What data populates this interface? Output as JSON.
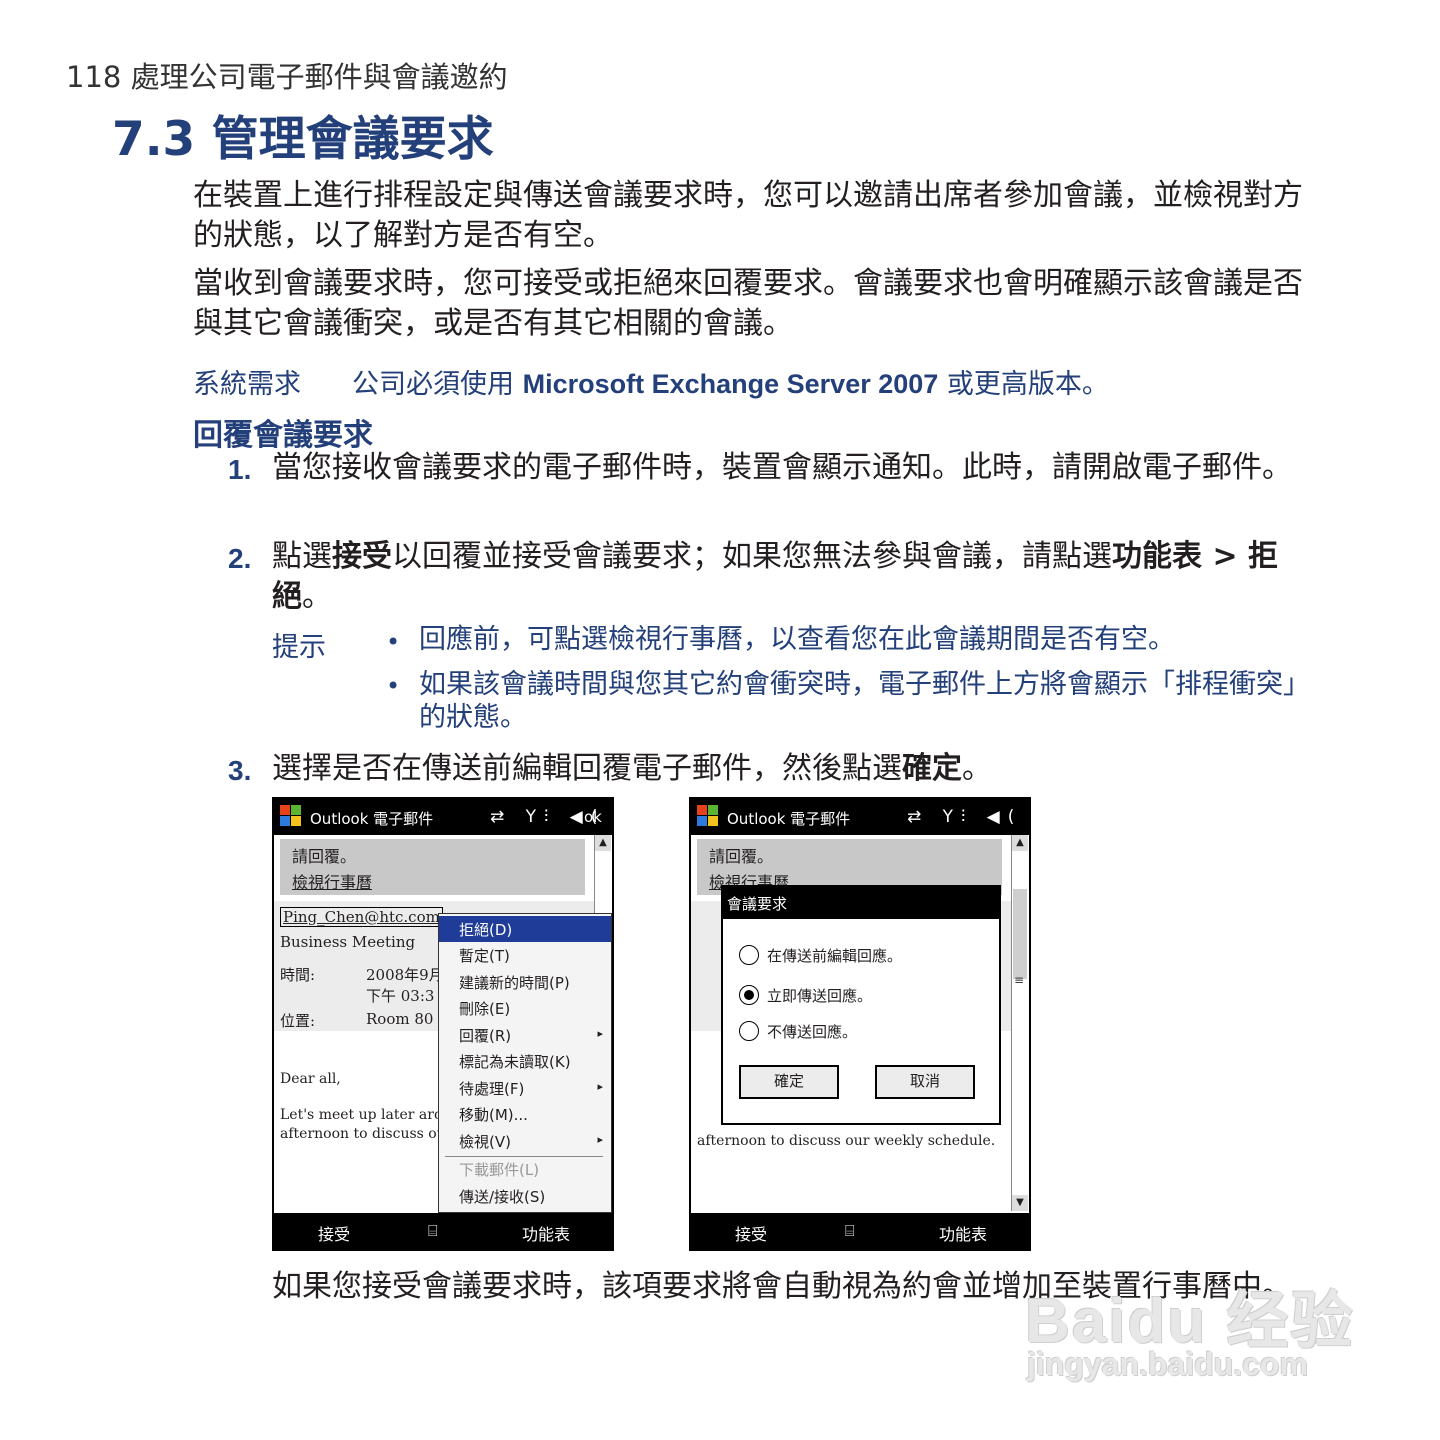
{
  "running_head": "118 處理公司電子郵件與會議邀約",
  "section_title": "7.3 管理會議要求",
  "paragraphs": [
    "在裝置上進行排程設定與傳送會議要求時，您可以邀請出席者參加會議，並檢視對方的狀態，以了解對方是否有空。",
    "當收到會議要求時，您可接受或拒絕來回覆要求。會議要求也會明確顯示該會議是否與其它會議衝突，或是否有其它相關的會議。"
  ],
  "requirement": {
    "label": "系統需求",
    "text_before": "公司必須使用 ",
    "text_bold": "Microsoft Exchange Server 2007",
    "text_after": " 或更高版本。"
  },
  "subheading": "回覆會議要求",
  "steps": [
    {
      "num": "1.",
      "text": "當您接收會議要求的電子郵件時，裝置會顯示通知。此時，請開啟電子郵件。"
    },
    {
      "num": "2.",
      "pre": "點選",
      "b1": "接受",
      "mid": "以回覆並接受會議要求；如果您無法參與會議，請點選",
      "b2": "功能表 > 拒絕",
      "post": "。"
    },
    {
      "num": "3.",
      "pre": "選擇是否在傳送前編輯回覆電子郵件，然後點選",
      "b1": "確定",
      "post": "。"
    }
  ],
  "tips": {
    "label": "提示",
    "bullet": "•",
    "items": [
      "回應前，可點選檢視行事曆，以查看您在此會議期間是否有空。",
      "如果該會議時間與您其它約會衝突時，電子郵件上方將會顯示「排程衝突」的狀態。"
    ]
  },
  "screens": {
    "title": "Outlook 電子郵件",
    "status_icons": "⇄ Y⫶ ◀(",
    "ok": "ok",
    "band_line1": "請回覆。",
    "band_line2": "檢視行事曆",
    "from": "Ping_Chen@htc.com",
    "subject": "Business Meeting",
    "time_label": "時間:",
    "time_value1": "2008年9月",
    "time_value2": "下午 03:3",
    "location_label": "位置:",
    "location_value": "Room 80",
    "body1": "Dear all,",
    "body2": "Let's meet up later aroun",
    "body3": "afternoon to discuss our",
    "body3_full": "afternoon to discuss our weekly schedule.",
    "soft_left": "接受",
    "soft_mid": "⌸",
    "soft_right": "功能表",
    "menu_items": [
      "拒絕(D)",
      "暫定(T)",
      "建議新的時間(P)",
      "刪除(E)",
      "回覆(R)",
      "標記為未讀取(K)",
      "待處理(F)",
      "移動(M)...",
      "檢視(V)",
      "下載郵件(L)",
      "傳送/接收(S)"
    ],
    "submenu_arrow": "▸",
    "dialog_title": "會議要求",
    "dialog_options": [
      "在傳送前編輯回應。",
      "立即傳送回應。",
      "不傳送回應。"
    ],
    "dialog_ok": "確定",
    "dialog_cancel": "取消",
    "scroll_up": "▲",
    "scroll_down": "▼",
    "scroll_grip": "≡"
  },
  "closing": "如果您接受會議要求時，該項要求將會自動視為約會並增加至裝置行事曆中。",
  "watermark": {
    "line1": "Baidu 经验",
    "line2": "jingyan.baidu.com"
  },
  "colors": {
    "heading_blue": "#24407a",
    "menu_highlight": "#1e3c98",
    "watermark": "#e7e7e7"
  }
}
